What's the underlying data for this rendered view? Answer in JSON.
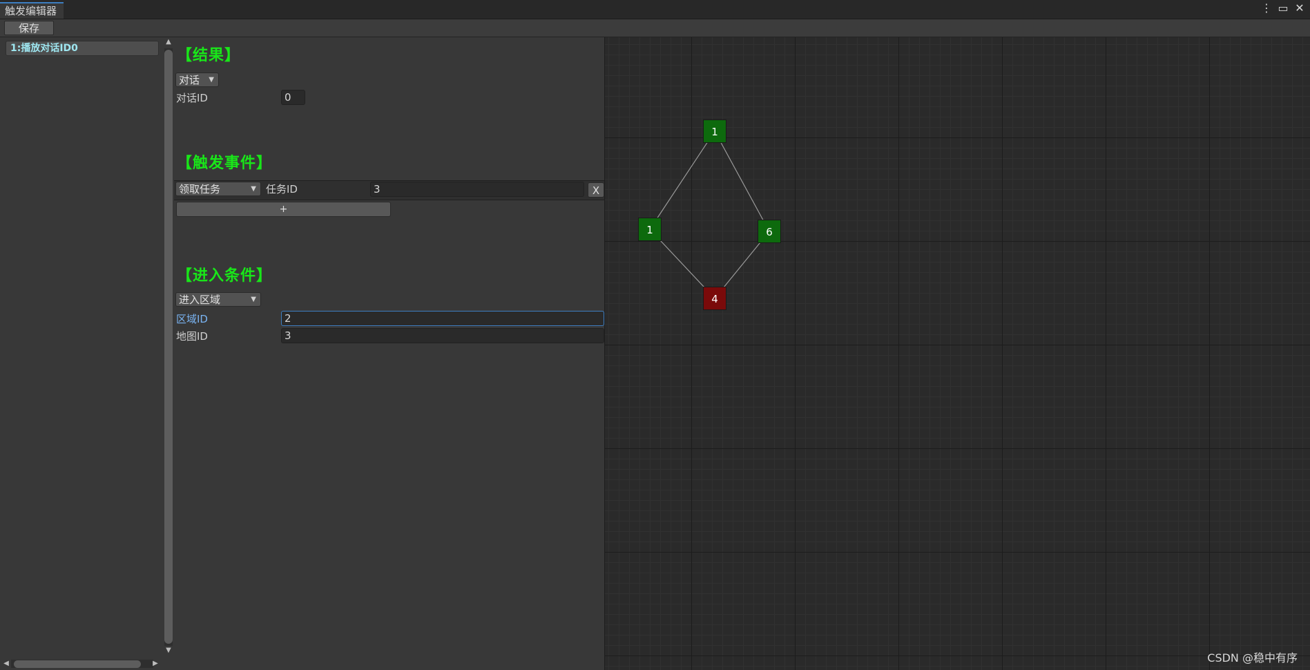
{
  "window": {
    "tab_title": "触发编辑器",
    "more_icon": "⋮",
    "maximize_icon": "▭",
    "close_icon": "✕"
  },
  "toolbar": {
    "save_label": "保存"
  },
  "left_list": {
    "items": [
      {
        "label": "1:播放对话ID0"
      }
    ]
  },
  "result": {
    "title": "【结果】",
    "type_dropdown": "对话",
    "fields": [
      {
        "label": "对话ID",
        "value": "0"
      }
    ]
  },
  "events": {
    "title": "【触发事件】",
    "rows": [
      {
        "type": "领取任务",
        "label": "任务ID",
        "value": "3",
        "remove_label": "X"
      }
    ],
    "add_label": "+"
  },
  "conditions": {
    "title": "【进入条件】",
    "type_dropdown": "进入区域",
    "fields": [
      {
        "label": "区域ID",
        "value": "2"
      },
      {
        "label": "地图ID",
        "value": "3"
      }
    ]
  },
  "graph": {
    "nodes": [
      {
        "label": "1",
        "status": "green"
      },
      {
        "label": "1",
        "status": "green"
      },
      {
        "label": "6",
        "status": "green"
      },
      {
        "label": "4",
        "status": "red"
      }
    ],
    "edges": [
      [
        0,
        1
      ],
      [
        0,
        2
      ],
      [
        1,
        3
      ],
      [
        2,
        3
      ]
    ],
    "colors": {
      "green": "#0d6a0d",
      "red": "#7a0a0a",
      "edge": "#9a9a9a"
    }
  },
  "watermark": "CSDN @稳中有序"
}
